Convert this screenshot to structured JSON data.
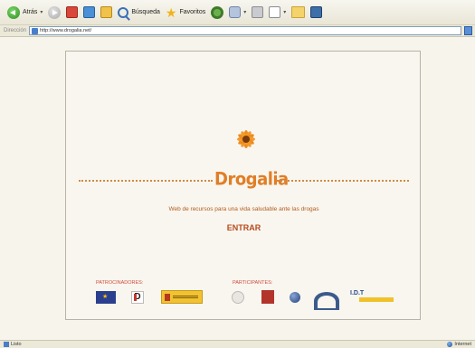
{
  "toolbar": {
    "back_label": "Atrás",
    "search_label": "Búsqueda",
    "favorites_label": "Favoritos",
    "dropdown_glyph": "▾"
  },
  "addressbar": {
    "label": "Dirección",
    "url": "http://www.drogalia.net/"
  },
  "page": {
    "brand": "Drogalia",
    "tagline": "Web de recursos para una vida saludable ante las drogas",
    "enter_label": "ENTRAR",
    "sponsors_label": "PATROCINADORES:",
    "participants_label": "PARTICIPANTES:"
  },
  "status": {
    "left": "Listo",
    "right": "Internet"
  },
  "colors": {
    "brand_orange": "#e17e26",
    "enter_red": "#b84a1d",
    "label_red": "#d24a3c",
    "page_bg": "#f8f6ef"
  },
  "icons": [
    "back-icon",
    "forward-icon",
    "stop-icon",
    "refresh-icon",
    "home-icon",
    "search-icon",
    "favorites-star-icon",
    "history-icon",
    "mail-icon",
    "print-icon",
    "edit-icon",
    "folder-icon",
    "media-icon",
    "page-icon",
    "go-icon",
    "flower-icon",
    "done-icon",
    "globe-icon"
  ]
}
